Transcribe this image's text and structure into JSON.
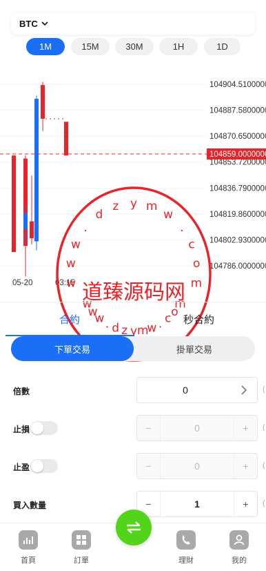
{
  "header": {
    "symbol": "BTC"
  },
  "timeframes": [
    {
      "label": "1M",
      "active": true
    },
    {
      "label": "15M",
      "active": false
    },
    {
      "label": "30M",
      "active": false
    },
    {
      "label": "1H",
      "active": false
    },
    {
      "label": "1D",
      "active": false
    }
  ],
  "chart_data": {
    "type": "candlestick",
    "price_levels": [
      "104904.5100000",
      "104887.5800000",
      "104870.6500000",
      "104853.7200000",
      "104836.7900000",
      "104819.8600000",
      "104802.9300000",
      "104786.0000000"
    ],
    "current_price": "104859.0000000",
    "x_labels": [
      "05-20",
      "03:15"
    ],
    "ylim": [
      104786.0,
      104904.51
    ],
    "candles": [
      {
        "open": 104858,
        "close": 104795,
        "high": 104858,
        "low": 104795,
        "color": "#e8232a"
      },
      {
        "open": 104799,
        "close": 104856,
        "high": 104858,
        "low": 104779,
        "color": "#e8232a"
      },
      {
        "open": 104820,
        "close": 104810,
        "high": 104825,
        "low": 104800,
        "color": "#1a6ff5"
      },
      {
        "open": 104804,
        "close": 104815,
        "high": 104845,
        "low": 104800,
        "color": "#e8232a"
      },
      {
        "open": 104802,
        "close": 104895,
        "high": 104897,
        "low": 104796,
        "color": "#1a6ff5"
      },
      {
        "open": 104904,
        "close": 104882,
        "high": 104906,
        "low": 104874,
        "color": "#e8232a"
      },
      {
        "open": 104880,
        "close": 104858,
        "high": 104880,
        "low": 104858,
        "color": "#e8232a"
      }
    ],
    "line_colors": {
      "up": "#1a6ff5",
      "down": "#e8232a",
      "price_line": "#e8232a"
    }
  },
  "watermark": {
    "site": "w w w . d z y m w . c o m",
    "cn_text": "道臻源码网",
    "color": "#e8232a"
  },
  "tabs": [
    {
      "label": "合約",
      "active": true
    },
    {
      "label": "秒合約",
      "active": false
    }
  ],
  "order_switch": {
    "primary": "下單交易",
    "secondary": "掛單交易"
  },
  "form": {
    "leverage": {
      "label": "倍數",
      "value": "0"
    },
    "stop_loss": {
      "label": "止損",
      "value": "0",
      "minus": "−",
      "plus": "+"
    },
    "take_profit": {
      "label": "止盈",
      "value": "0",
      "minus": "−",
      "plus": "+"
    },
    "quantity": {
      "label": "買入數量",
      "value": "1",
      "minus": "−",
      "plus": "+"
    }
  },
  "nav": {
    "items": [
      {
        "label": "首頁",
        "icon": "chart-icon"
      },
      {
        "label": "訂單",
        "icon": "grid-icon"
      },
      {
        "label": "理財",
        "icon": "phone-icon"
      },
      {
        "label": "我的",
        "icon": "user-icon"
      }
    ],
    "fab_icon": "swap-icon",
    "fab_color": "#52d41a"
  }
}
